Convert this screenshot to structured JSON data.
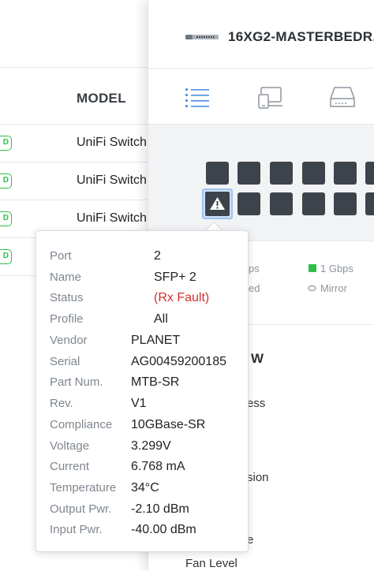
{
  "device_list": {
    "column_header": "MODEL",
    "rows": [
      {
        "status": "D",
        "model": "UniFi Switch"
      },
      {
        "status": "D",
        "model": "UniFi Switch"
      },
      {
        "status": "D",
        "model": "UniFi Switch"
      },
      {
        "status": "D",
        "model": ""
      }
    ]
  },
  "panel": {
    "title": "16XG2-MASTERBEDR...",
    "tabs": [
      {
        "icon": "list-icon",
        "active": true
      },
      {
        "icon": "devices-icon",
        "active": false
      },
      {
        "icon": "hard-drive-icon",
        "active": false
      }
    ],
    "legend": [
      {
        "text": "ps"
      },
      {
        "text": "1 Gbps",
        "color": "#2fbf48"
      },
      {
        "text": "ed"
      },
      {
        "text": "Mirror"
      }
    ],
    "section_title": "W",
    "properties": [
      "ess",
      "sion",
      "e",
      "Fan Level"
    ]
  },
  "tooltip": {
    "rows": [
      {
        "label": "Port",
        "value": "2"
      },
      {
        "label": "Name",
        "value": "SFP+ 2"
      },
      {
        "label": "Status",
        "value": "(Rx Fault)"
      },
      {
        "label": "Profile",
        "value": "All"
      },
      {
        "label": "Vendor",
        "value": "PLANET"
      },
      {
        "label": "Serial",
        "value": "AG00459200185"
      },
      {
        "label": "Part Num.",
        "value": "MTB-SR"
      },
      {
        "label": "Rev.",
        "value": "V1"
      },
      {
        "label": "Compliance",
        "value": "10GBase-SR"
      },
      {
        "label": "Voltage",
        "value": "3.299V"
      },
      {
        "label": "Current",
        "value": "6.768 mA"
      },
      {
        "label": "Temperature",
        "value": "34°C"
      },
      {
        "label": "Output Pwr.",
        "value": "-2.10 dBm"
      },
      {
        "label": "Input Pwr.",
        "value": "-40.00 dBm"
      }
    ],
    "fault_color": "#d32f2f"
  },
  "colors": {
    "accent": "#4a90e2",
    "online": "#2fbf48",
    "port": "#3d434b"
  }
}
